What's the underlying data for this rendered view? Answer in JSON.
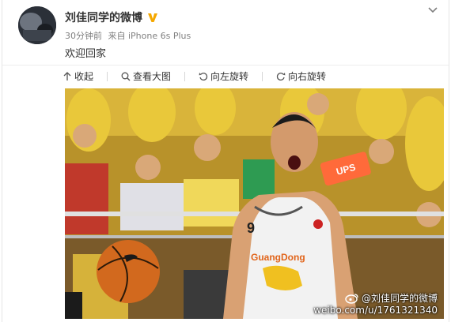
{
  "post": {
    "author": "刘佳同学的微博",
    "time": "30分钟前",
    "source": "来自 iPhone 6s Plus",
    "text": "欢迎回家"
  },
  "toolbar": {
    "collapse_label": "收起",
    "view_large_label": "查看大图",
    "rotate_left_label": "向左旋转",
    "rotate_right_label": "向右旋转"
  },
  "photo": {
    "watermark_name": "@刘佳同学的微博",
    "watermark_url": "weibo.com/u/1761321340",
    "jersey_number": "9",
    "jersey_team": "GuangDong",
    "sign_text": "UPS"
  },
  "colors": {
    "verified_badge": "#f5a800",
    "crowd_yellow": "#e8c42a",
    "jersey_white": "#f2f2f2",
    "ball_orange": "#d2691e"
  }
}
